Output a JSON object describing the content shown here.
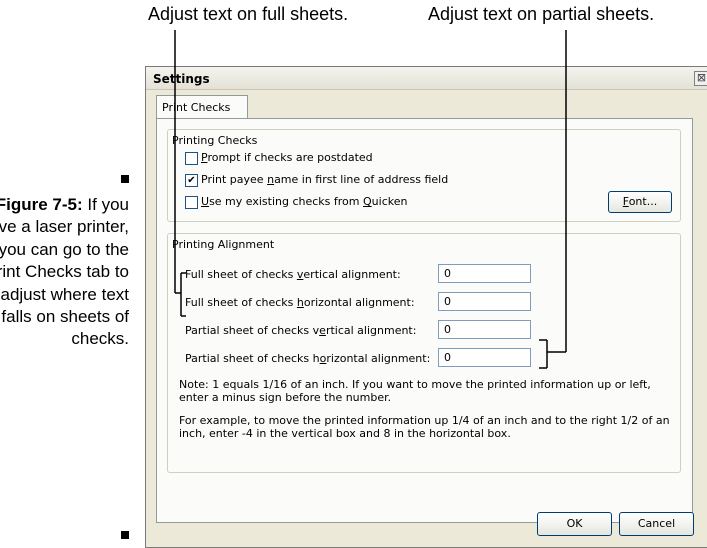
{
  "callouts": {
    "full": "Adjust text on full sheets.",
    "partial": "Adjust text on partial sheets."
  },
  "figure": {
    "label": "Figure 7-5:",
    "caption": "If you have a laser printer, you can go to the Print Checks tab to adjust where text falls on sheets of checks."
  },
  "dialog": {
    "title": "Settings",
    "close_glyph": "⊠",
    "tab_label": "Print Checks",
    "printing_checks": {
      "title": "Printing Checks",
      "options": [
        {
          "pre": "",
          "key": "P",
          "post": "rompt if checks are postdated",
          "checked": false
        },
        {
          "pre": "Print payee ",
          "key": "n",
          "post": "ame in first line of address field",
          "checked": true
        },
        {
          "pre": "",
          "key": "U",
          "post": "se my existing checks from ",
          "key2": "Q",
          "post2": "uicken",
          "checked": false
        }
      ],
      "font_button": {
        "key": "F",
        "rest": "ont..."
      }
    },
    "printing_alignment": {
      "title": "Printing Alignment",
      "fields": [
        {
          "pre": "Full sheet of checks ",
          "key": "v",
          "post": "ertical alignment:",
          "value": "0"
        },
        {
          "pre": "Full sheet of checks ",
          "key": "h",
          "post": "orizontal alignment:",
          "value": "0"
        },
        {
          "pre": "Partial sheet of checks v",
          "key": "e",
          "post": "rtical alignment:",
          "value": "0"
        },
        {
          "pre": "Partial sheet of checks h",
          "key": "o",
          "post": "rizontal alignment:",
          "value": "0"
        }
      ],
      "note1": "Note: 1 equals 1/16 of an inch. If you want to move the printed information up or left, enter a minus sign before the number.",
      "note2": "For example, to move the printed information up 1/4 of an inch and to the right 1/2 of an inch, enter -4 in the vertical box and 8 in the horizontal box."
    },
    "buttons": {
      "ok": "OK",
      "cancel": "Cancel"
    }
  }
}
